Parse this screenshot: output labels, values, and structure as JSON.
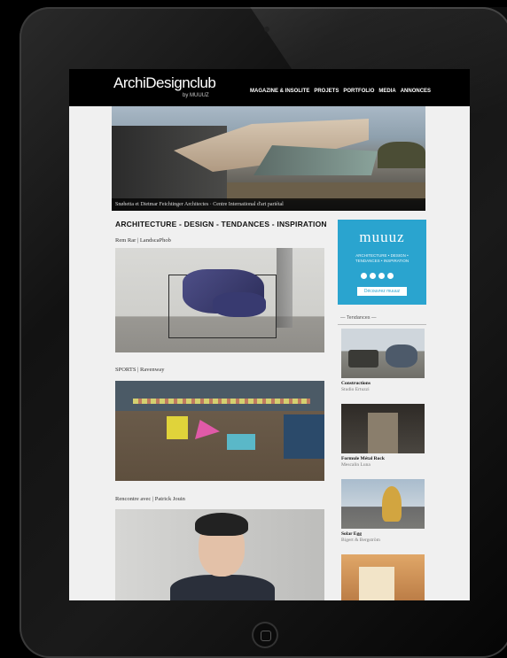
{
  "site": {
    "logo": "ArchiDesignclub",
    "logo_sub": "by MUUUZ",
    "menu": [
      "MAGAZINE & INSOLITE",
      "PROJETS",
      "PORTFOLIO",
      "MEDIA",
      "ANNONCES"
    ]
  },
  "hero": {
    "caption": "Snøhetta et Dietmar Feichtinger Architectes · Centre International d'art pariétal"
  },
  "main": {
    "tagline": "ARCHITECTURE - DESIGN - TENDANCES - INSPIRATION",
    "posts": [
      {
        "title": "Rem Rar | LandscaPhob"
      },
      {
        "title": "SPORTS | Ravenway"
      },
      {
        "title": "Rencontre avec | Patrick Jouin"
      }
    ]
  },
  "sidebar": {
    "ad": {
      "logo": "muuuz",
      "text": "ARCHITECTURE • DESIGN • TENDANCES • INSPIRATION",
      "button": "Découvrez muuuz"
    },
    "heading": "— Tendances —",
    "items": [
      {
        "title": "Constructions",
        "subtitle": "Studio Ertuzzi"
      },
      {
        "title": "Formule Métal Rock",
        "subtitle": "Mescalin Luna"
      },
      {
        "title": "Solar Egg",
        "subtitle": "Bigert & Bergström"
      }
    ]
  },
  "colors": {
    "ad_blue": "#2aa4cf",
    "nav_bg": "#000000"
  }
}
